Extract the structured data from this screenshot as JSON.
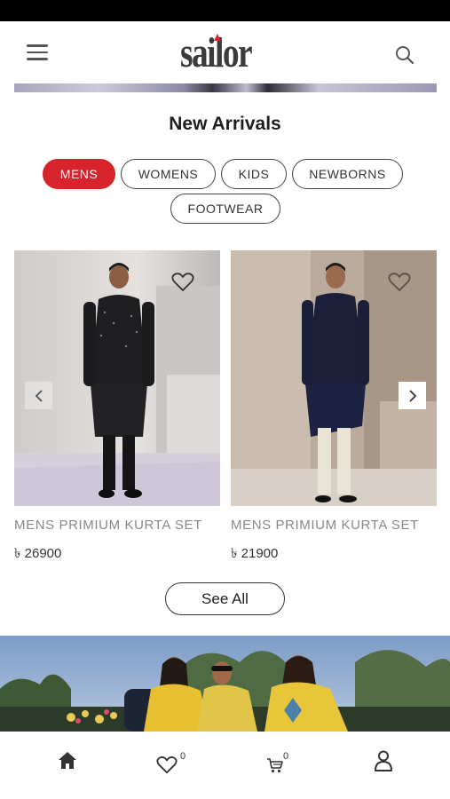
{
  "header": {
    "brand": "sailor"
  },
  "section": {
    "title": "New Arrivals"
  },
  "filters": [
    {
      "label": "MENS",
      "active": true
    },
    {
      "label": "WOMENS",
      "active": false
    },
    {
      "label": "KIDS",
      "active": false
    },
    {
      "label": "NEWBORNS",
      "active": false
    },
    {
      "label": "FOOTWEAR",
      "active": false
    }
  ],
  "products": [
    {
      "name": "MENS PRIMIUM KURTA SET",
      "price": "৳ 26900"
    },
    {
      "name": "MENS PRIMIUM KURTA SET",
      "price": "৳ 21900"
    }
  ],
  "see_all": {
    "label": "See All"
  },
  "bottom_nav": {
    "wishlist_count": "0",
    "cart_count": "0"
  },
  "colors": {
    "accent": "#d7232b",
    "text": "#1e1e1e",
    "muted": "#888888"
  }
}
